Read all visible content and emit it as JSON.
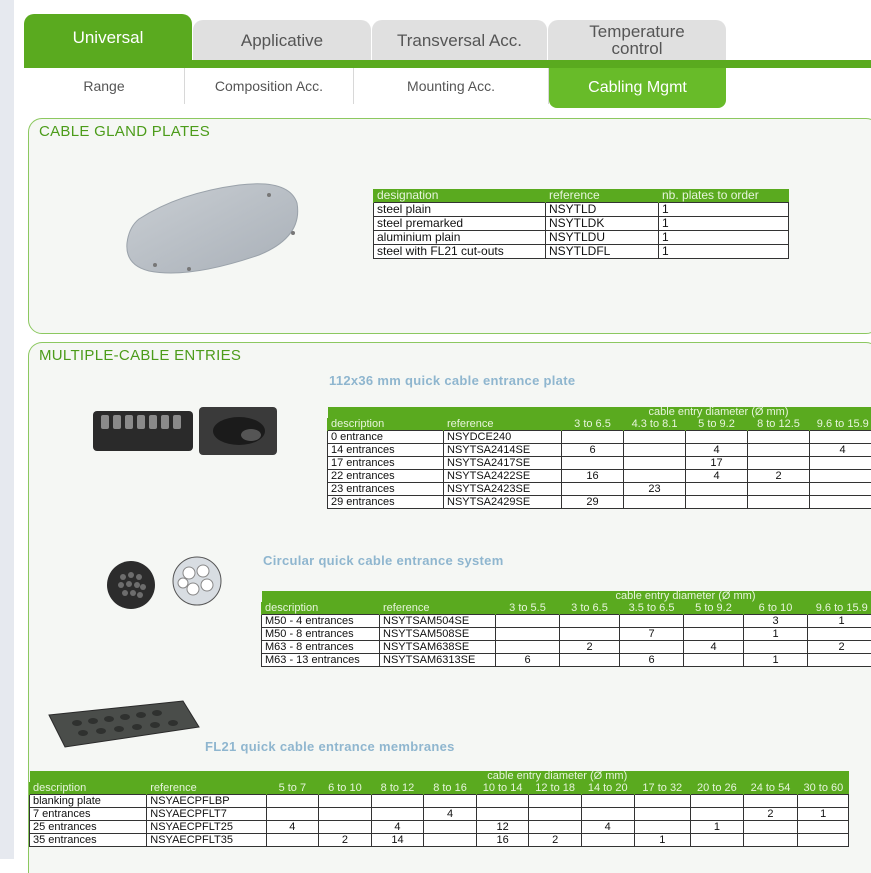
{
  "main_tabs": [
    {
      "label": "Universal",
      "active": true
    },
    {
      "label": "Applicative",
      "active": false
    },
    {
      "label": "Transversal Acc.",
      "active": false
    },
    {
      "label": "Temperature control",
      "active": false
    }
  ],
  "sub_tabs": [
    {
      "label": "Range",
      "active": false
    },
    {
      "label": "Composition Acc.",
      "active": false
    },
    {
      "label": "Mounting Acc.",
      "active": false
    },
    {
      "label": "Cabling Mgmt",
      "active": true
    }
  ],
  "colors": {
    "accent": "#5aaa1f",
    "section_border": "#8cc860",
    "subtitle": "#8fb6cf"
  },
  "gland_plates": {
    "title": "CABLE GLAND PLATES",
    "headers": [
      "designation",
      "reference",
      "nb. plates to order"
    ],
    "rows": [
      [
        "steel plain",
        "NSYTLD",
        "1"
      ],
      [
        "steel premarked",
        "NSYTLDK",
        "1"
      ],
      [
        "aluminium plain",
        "NSYTLDU",
        "1"
      ],
      [
        "steel with FL21 cut-outs",
        "NSYTLDFL",
        "1"
      ]
    ]
  },
  "multi_entries": {
    "title": "MULTIPLE-CABLE ENTRIES",
    "plate": {
      "title": "112x36 mm quick cable entrance plate",
      "group_header": "cable entry diameter (Ø mm)",
      "headers": [
        "description",
        "reference",
        "3 to 6.5",
        "4.3 to 8.1",
        "5 to 9.2",
        "8 to 12.5",
        "9.6 to 15.9"
      ],
      "rows": [
        [
          "0 entrance",
          "NSYDCE240",
          "",
          "",
          "",
          "",
          ""
        ],
        [
          "14 entrances",
          "NSYTSA2414SE",
          "6",
          "",
          "4",
          "",
          "4"
        ],
        [
          "17 entrances",
          "NSYTSA2417SE",
          "",
          "",
          "17",
          "",
          ""
        ],
        [
          "22 entrances",
          "NSYTSA2422SE",
          "16",
          "",
          "4",
          "2",
          ""
        ],
        [
          "23 entrances",
          "NSYTSA2423SE",
          "",
          "23",
          "",
          "",
          ""
        ],
        [
          "29 entrances",
          "NSYTSA2429SE",
          "29",
          "",
          "",
          "",
          ""
        ]
      ]
    },
    "circular": {
      "title": "Circular quick cable entrance system",
      "group_header": "cable entry diameter (Ø mm)",
      "headers": [
        "description",
        "reference",
        "3 to 5.5",
        "3 to 6.5",
        "3.5 to 6.5",
        "5 to 9.2",
        "6 to 10",
        "9.6 to 15.9"
      ],
      "rows": [
        [
          "M50 - 4 entrances",
          "NSYTSAM504SE",
          "",
          "",
          "",
          "",
          "3",
          "1"
        ],
        [
          "M50 - 8 entrances",
          "NSYTSAM508SE",
          "",
          "",
          "7",
          "",
          "1",
          ""
        ],
        [
          "M63 - 8 entrances",
          "NSYTSAM638SE",
          "",
          "2",
          "",
          "4",
          "",
          "2"
        ],
        [
          "M63 - 13 entrances",
          "NSYTSAM6313SE",
          "6",
          "",
          "6",
          "",
          "1",
          ""
        ]
      ]
    },
    "fl21": {
      "title": "FL21 quick cable entrance membranes",
      "group_header": "cable entry diameter (Ø mm)",
      "headers": [
        "description",
        "reference",
        "5 to 7",
        "6 to 10",
        "8 to 12",
        "8 to 16",
        "10 to 14",
        "12 to 18",
        "14 to 20",
        "17 to 32",
        "20 to 26",
        "24 to 54",
        "30 to 60"
      ],
      "rows": [
        [
          "blanking plate",
          "NSYAECPFLBP",
          "",
          "",
          "",
          "",
          "",
          "",
          "",
          "",
          "",
          "",
          ""
        ],
        [
          "7 entrances",
          "NSYAECPFLT7",
          "",
          "",
          "",
          "4",
          "",
          "",
          "",
          "",
          "",
          "2",
          "1"
        ],
        [
          "25 entrances",
          "NSYAECPFLT25",
          "4",
          "",
          "4",
          "",
          "12",
          "",
          "4",
          "",
          "1",
          "",
          ""
        ],
        [
          "35 entrances",
          "NSYAECPFLT35",
          "",
          "2",
          "14",
          "",
          "16",
          "2",
          "",
          "1",
          "",
          "",
          ""
        ]
      ]
    }
  }
}
